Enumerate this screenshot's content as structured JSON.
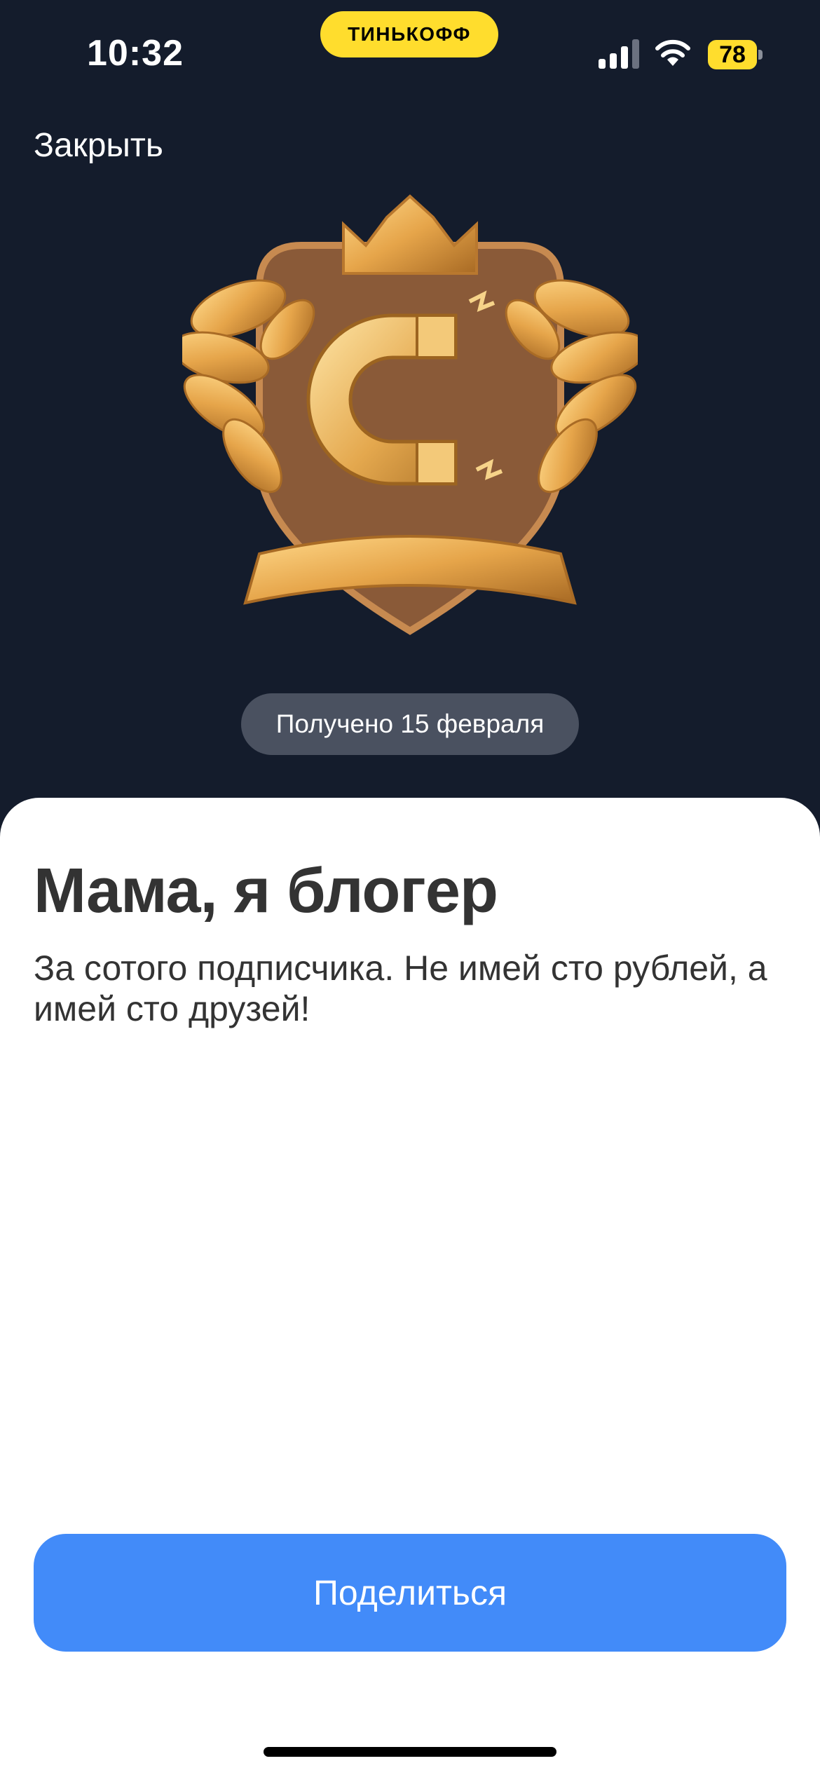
{
  "status_bar": {
    "time": "10:32",
    "brand": "ТИНЬКОФФ",
    "battery": "78",
    "icons": [
      "signal-icon",
      "wifi-icon",
      "battery-icon"
    ]
  },
  "header": {
    "close_label": "Закрыть"
  },
  "achievement": {
    "badge_icon": "magnet-crest-badge",
    "received_label": "Получено 15 февраля",
    "title": "Мама, я блогер",
    "description": "За сотого подписчика. Не имей сто рублей, а имей сто друзей!"
  },
  "actions": {
    "share_label": "Поделиться"
  },
  "colors": {
    "background": "#141c2c",
    "brand_yellow": "#ffdd2d",
    "chip": "#4a5160",
    "button": "#428bf9",
    "gold": "#e0a045"
  }
}
